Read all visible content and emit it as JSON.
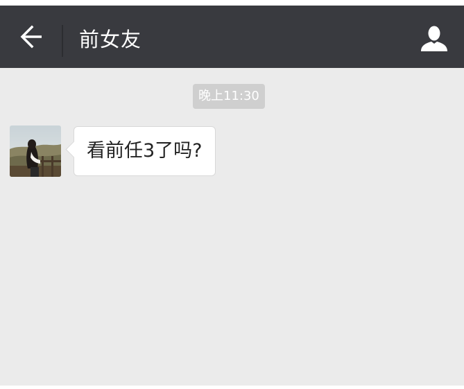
{
  "header": {
    "back_icon": "arrow-left-icon",
    "title": "前女友",
    "profile_icon": "person-icon"
  },
  "chat": {
    "timestamp": "晚上11:30",
    "messages": [
      {
        "sender": "contact",
        "avatar": "avatar-photo",
        "text": "看前任3了吗?"
      }
    ]
  },
  "colors": {
    "header_bg": "#393a3f",
    "chat_bg": "#ebebeb",
    "timestamp_bg": "#cfcfcf",
    "bubble_bg": "#ffffff"
  }
}
